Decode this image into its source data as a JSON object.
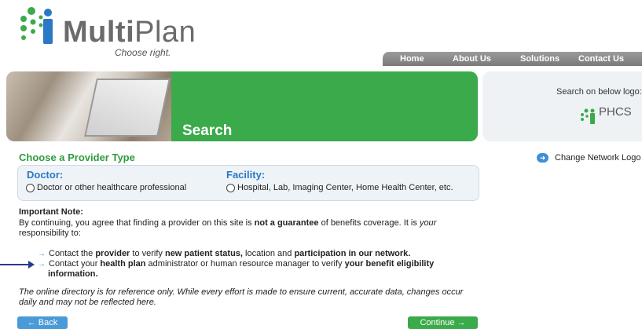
{
  "brand": {
    "name_bold": "Multi",
    "name_light": "Plan",
    "tagline": "Choose right.",
    "green": "#3aaa4a",
    "blue": "#2a78c6"
  },
  "nav": {
    "items": [
      "Home",
      "About Us",
      "Solutions",
      "Contact Us"
    ]
  },
  "banner": {
    "title": "Search"
  },
  "logo_panel": {
    "label": "Search on below logo:",
    "logo_text": "PHCS"
  },
  "change_network": {
    "label": "Change Network Logo"
  },
  "provider": {
    "section_title": "Choose a Provider Type",
    "doctor": {
      "heading": "Doctor:",
      "option": "Doctor or other healthcare professional"
    },
    "facility": {
      "heading": "Facility:",
      "option": "Hospital, Lab, Imaging Center, Home Health Center, etc."
    }
  },
  "note": {
    "heading": "Important Note:",
    "body_1": "By continuing, you agree that finding a provider on this site is ",
    "body_bold": "not a guarantee",
    "body_2": " of benefits coverage. It is ",
    "body_italic": "your",
    "body_3": " responsibility to:",
    "b1_1": "Contact the ",
    "b1_bold1": "provider",
    "b1_2": " to verify ",
    "b1_bold2": "new patient status,",
    "b1_3": " location and ",
    "b1_bold3": "participation in our network.",
    "b2_1": "Contact your ",
    "b2_bold1": "health plan",
    "b2_2": " administrator or human resource manager to verify ",
    "b2_bold2": "your benefit eligibility information.",
    "disclaimer": "The online directory is for reference only. While every effort is made to ensure current, accurate data, changes occur daily and may not be reflected here."
  },
  "buttons": {
    "back": "← Back",
    "continue": "Continue →"
  }
}
